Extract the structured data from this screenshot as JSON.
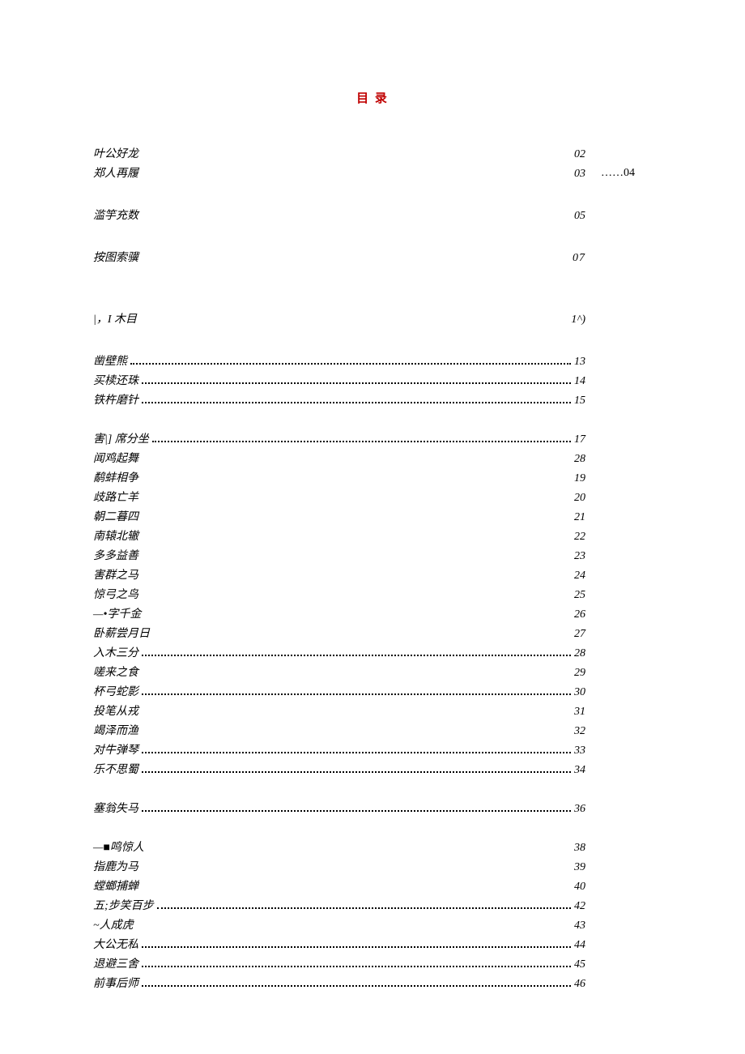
{
  "title": "目 录",
  "floating": "……04",
  "entries": [
    {
      "label": "叶公好龙",
      "page": "02",
      "dotted": false,
      "gap_before": ""
    },
    {
      "label": "郑人再履",
      "page": "03",
      "dotted": false,
      "gap_before": ""
    },
    {
      "label": "滥竽充数",
      "page": "05",
      "dotted": false,
      "gap_before": "gap-med"
    },
    {
      "label": "按图索骥",
      "page": "07",
      "dotted": false,
      "gap_before": "gap-med",
      "page_italic": true
    },
    {
      "label": "|，I 木目",
      "page": "1^)",
      "dotted": false,
      "gap_before": "gap-large"
    },
    {
      "label": "凿壁熊",
      "page": "13",
      "dotted": true,
      "gap_before": "gap-med"
    },
    {
      "label": "买椟还珠",
      "page": "14",
      "dotted": true,
      "gap_before": ""
    },
    {
      "label": "铁杵磨针",
      "page": "15",
      "dotted": true,
      "gap_before": ""
    },
    {
      "label": "害|] 席分坐",
      "page": "17",
      "dotted": true,
      "gap_before": "gap-small"
    },
    {
      "label": "闻鸡起舞",
      "page": "28",
      "dotted": false,
      "gap_before": ""
    },
    {
      "label": "鹬蚌相争",
      "page": "19",
      "dotted": false,
      "gap_before": ""
    },
    {
      "label": "歧路亡羊",
      "page": "20",
      "dotted": false,
      "gap_before": ""
    },
    {
      "label": "朝二暮四",
      "page": "21",
      "dotted": false,
      "gap_before": ""
    },
    {
      "label": "南辕北辙",
      "page": "22",
      "dotted": false,
      "gap_before": ""
    },
    {
      "label": "多多益善",
      "page": "23",
      "dotted": false,
      "gap_before": ""
    },
    {
      "label": "害群之马",
      "page": "24",
      "dotted": false,
      "gap_before": ""
    },
    {
      "label": "惊弓之鸟",
      "page": "25",
      "dotted": false,
      "gap_before": ""
    },
    {
      "label": "—•字千金",
      "page": "26",
      "dotted": false,
      "gap_before": ""
    },
    {
      "label": "卧薪尝月日",
      "page": "27",
      "dotted": false,
      "gap_before": ""
    },
    {
      "label": "入木三分",
      "page": "28",
      "dotted": true,
      "gap_before": ""
    },
    {
      "label": "嗟来之食",
      "page": "29",
      "dotted": false,
      "gap_before": ""
    },
    {
      "label": "杯弓蛇影",
      "page": "30",
      "dotted": true,
      "gap_before": ""
    },
    {
      "label": "投笔从戎",
      "page": "31",
      "dotted": false,
      "gap_before": ""
    },
    {
      "label": "竭泽而渔",
      "page": "32",
      "dotted": false,
      "gap_before": ""
    },
    {
      "label": "对牛弹琴",
      "page": "33",
      "dotted": true,
      "gap_before": ""
    },
    {
      "label": "乐不思蜀",
      "page": "34",
      "dotted": true,
      "gap_before": ""
    },
    {
      "label": "塞翁失马",
      "page": "36",
      "dotted": true,
      "gap_before": "gap-small"
    },
    {
      "label": "—■鸣惊人",
      "page": "38",
      "dotted": false,
      "gap_before": "gap-small",
      "square": true
    },
    {
      "label": "指鹿为马",
      "page": "39",
      "dotted": false,
      "gap_before": ""
    },
    {
      "label": "螳螂捕蝉",
      "page": "40",
      "dotted": false,
      "gap_before": ""
    },
    {
      "label": "五;步笑百步",
      "page": "42",
      "dotted": true,
      "gap_before": ""
    },
    {
      "label": "~人成虎",
      "page": "43",
      "dotted": false,
      "gap_before": ""
    },
    {
      "label": "大公无私",
      "page": "44",
      "dotted": true,
      "gap_before": ""
    },
    {
      "label": "退避三舍",
      "page": "45",
      "dotted": true,
      "gap_before": ""
    },
    {
      "label": "前事后师",
      "page": "46",
      "dotted": true,
      "gap_before": ""
    }
  ]
}
